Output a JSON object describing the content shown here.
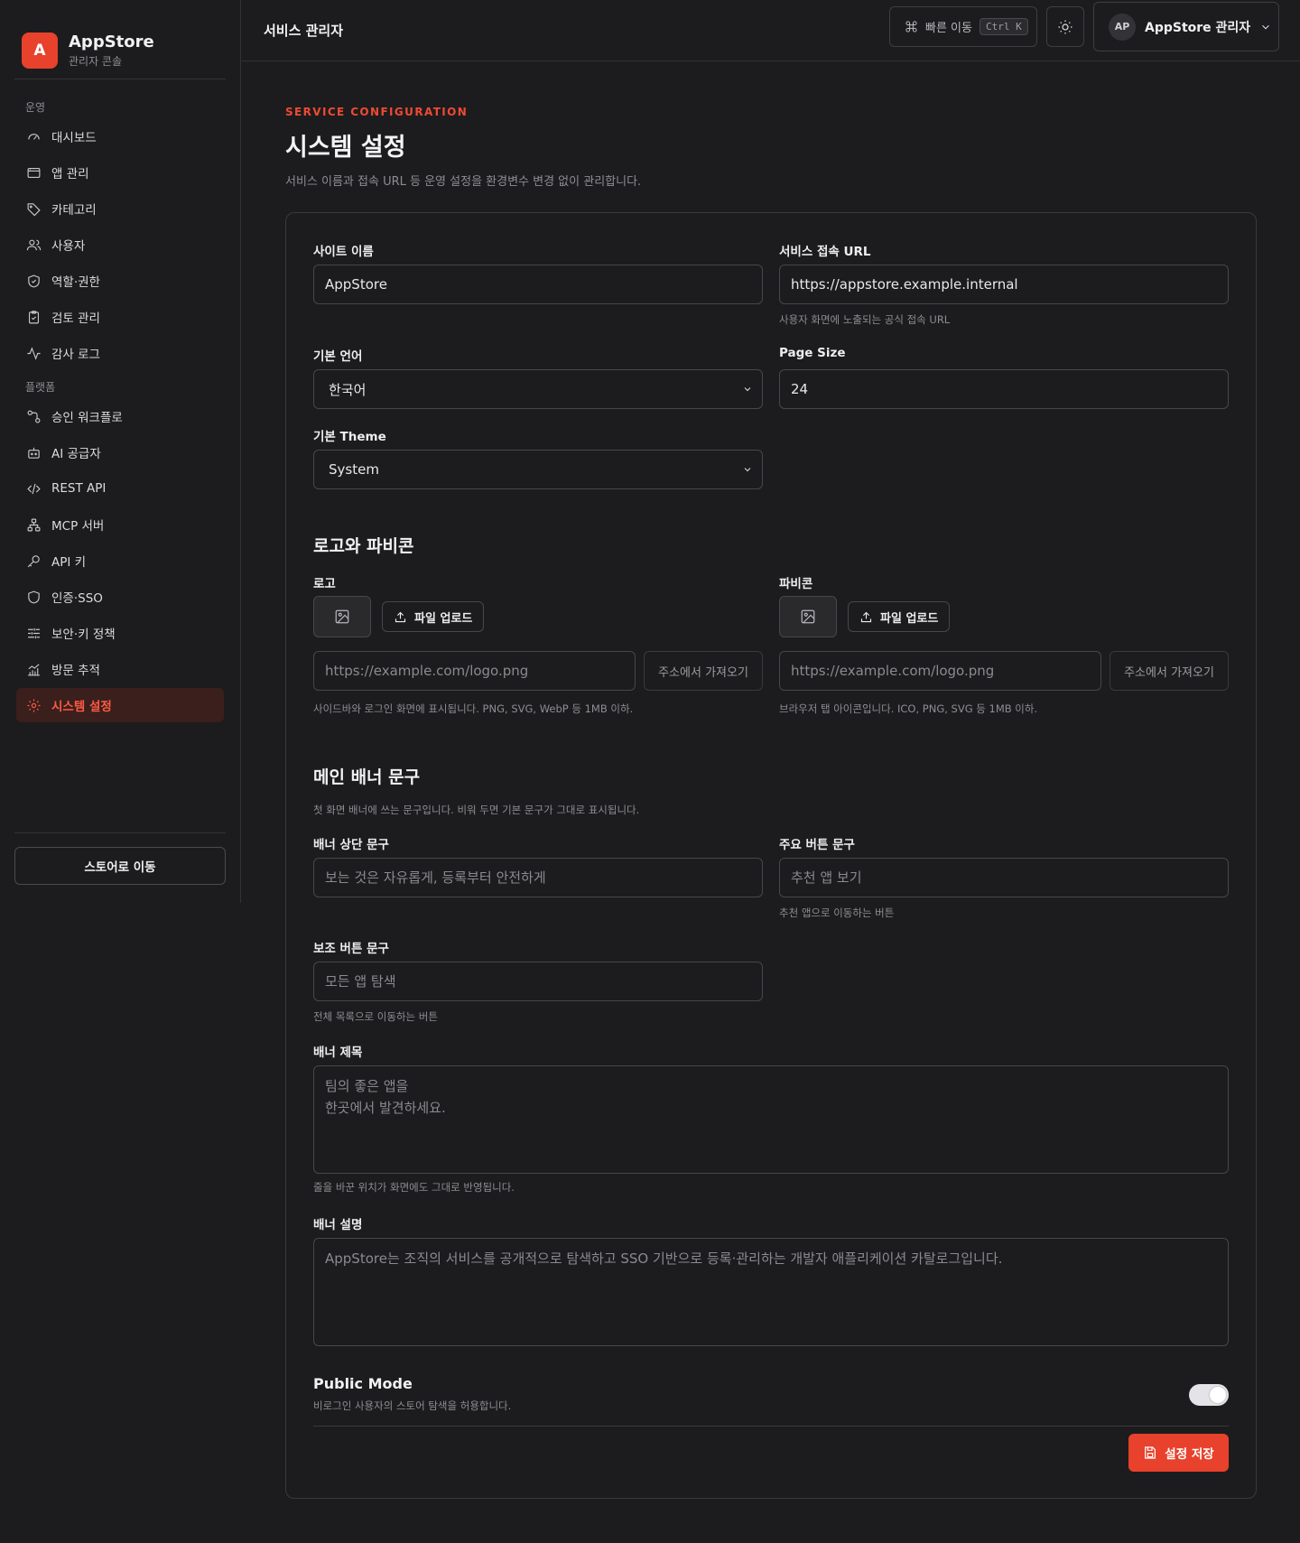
{
  "brand": {
    "logo_letter": "A",
    "name": "AppStore",
    "subtitle": "관리자 콘솔"
  },
  "sidebar": {
    "section_ops": "운영",
    "ops_items": [
      {
        "label": "대시보드",
        "icon": "dashboard-icon"
      },
      {
        "label": "앱 관리",
        "icon": "window-icon"
      },
      {
        "label": "카테고리",
        "icon": "tag-icon"
      },
      {
        "label": "사용자",
        "icon": "users-icon"
      },
      {
        "label": "역할·권한",
        "icon": "shield-check-icon"
      },
      {
        "label": "검토 관리",
        "icon": "clipboard-check-icon"
      },
      {
        "label": "감사 로그",
        "icon": "activity-icon"
      }
    ],
    "section_platform": "플랫폼",
    "platform_items": [
      {
        "label": "승인 워크플로",
        "icon": "workflow-icon"
      },
      {
        "label": "AI 공급자",
        "icon": "bot-icon"
      },
      {
        "label": "REST API",
        "icon": "code-icon"
      },
      {
        "label": "MCP 서버",
        "icon": "network-icon"
      },
      {
        "label": "API 키",
        "icon": "key-icon"
      },
      {
        "label": "인증·SSO",
        "icon": "shield-icon"
      },
      {
        "label": "보안·키 정책",
        "icon": "sliders-icon"
      },
      {
        "label": "방문 추적",
        "icon": "chart-icon"
      },
      {
        "label": "시스템 설정",
        "icon": "gear-icon",
        "active": true
      }
    ],
    "store_button": "스토어로 이동"
  },
  "topbar": {
    "title": "서비스 관리자",
    "quick_label": "빠른 이동",
    "quick_shortcut": "Ctrl K",
    "user_initials": "AP",
    "user_name": "AppStore 관리자"
  },
  "page": {
    "eyebrow": "SERVICE CONFIGURATION",
    "title": "시스템 설정",
    "description": "서비스 이름과 접속 URL 등 운영 설정을 환경변수 변경 없이 관리합니다."
  },
  "form": {
    "site_name_label": "사이트 이름",
    "site_name_value": "AppStore",
    "url_label": "서비스 접속 URL",
    "url_value": "https://appstore.example.internal",
    "url_hint": "사용자 화면에 노출되는 공식 접속 URL",
    "language_label": "기본 언어",
    "language_value": "한국어",
    "page_size_label": "Page Size",
    "page_size_value": "24",
    "theme_label": "기본 Theme",
    "theme_value": "System",
    "logo_section_title": "로고와 파비콘",
    "logo_label": "로고",
    "favicon_label": "파비콘",
    "upload_label": "파일 업로드",
    "logo_url_placeholder": "https://example.com/logo.png",
    "favicon_url_placeholder": "https://example.com/logo.png",
    "fetch_label": "주소에서 가져오기",
    "logo_hint": "사이드바와 로그인 화면에 표시됩니다. PNG, SVG, WebP 등 1MB 이하.",
    "favicon_hint": "브라우저 탭 아이콘입니다. ICO, PNG, SVG 등 1MB 이하.",
    "banner_section_title": "메인 배너 문구",
    "banner_section_desc": "첫 화면 배너에 쓰는 문구입니다. 비워 두면 기본 문구가 그대로 표시됩니다.",
    "banner_top_label": "배너 상단 문구",
    "banner_top_placeholder": "보는 것은 자유롭게, 등록부터 안전하게",
    "primary_btn_label": "주요 버튼 문구",
    "primary_btn_placeholder": "추천 앱 보기",
    "primary_btn_hint": "추천 앱으로 이동하는 버튼",
    "secondary_btn_label": "보조 버튼 문구",
    "secondary_btn_placeholder": "모든 앱 탐색",
    "secondary_btn_hint": "전체 목록으로 이동하는 버튼",
    "banner_title_label": "배너 제목",
    "banner_title_placeholder": "팀의 좋은 앱을\n한곳에서 발견하세요.",
    "banner_title_hint": "줄을 바꾼 위치가 화면에도 그대로 반영됩니다.",
    "banner_desc_label": "배너 설명",
    "banner_desc_placeholder": "AppStore는 조직의 서비스를 공개적으로 탐색하고 SSO 기반으로 등록·관리하는 개발자 애플리케이션 카탈로그입니다.",
    "public_mode_title": "Public Mode",
    "public_mode_desc": "비로그인 사용자의 스토어 탐색을 허용합니다.",
    "public_mode_on": true,
    "save_label": "설정 저장"
  },
  "colors": {
    "accent": "#e8412c",
    "background": "#1c1c1e",
    "border": "#3a3a3e"
  }
}
